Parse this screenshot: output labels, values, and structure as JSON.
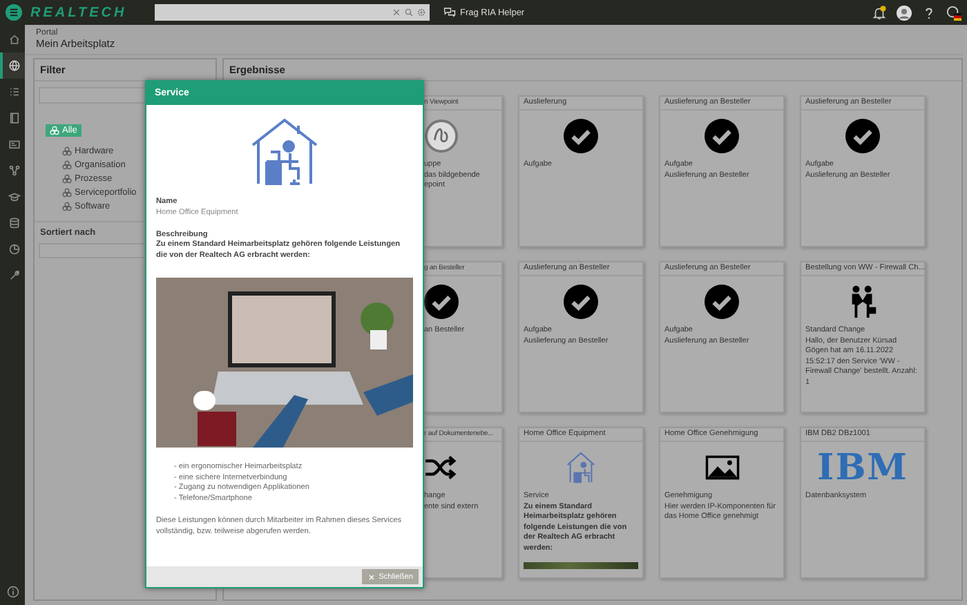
{
  "topbar": {
    "logo": "REALTECH",
    "assistant": "Frag RIA Helper"
  },
  "sidebar": {
    "items": [
      {
        "kind": "home",
        "selected": false
      },
      {
        "kind": "globe",
        "selected": true
      },
      {
        "kind": "list",
        "selected": false
      },
      {
        "kind": "book",
        "selected": false
      },
      {
        "kind": "card",
        "selected": false
      },
      {
        "kind": "network",
        "selected": false
      },
      {
        "kind": "cap",
        "selected": false
      },
      {
        "kind": "database",
        "selected": false
      },
      {
        "kind": "chart",
        "selected": false
      },
      {
        "kind": "wrench",
        "selected": false
      }
    ]
  },
  "breadcrumb": {
    "parent": "Portal",
    "title": "Mein Arbeitsplatz"
  },
  "filter": {
    "title": "Filter",
    "tree": [
      {
        "label": "Alle",
        "selected": true,
        "children": [
          {
            "label": "Hardware",
            "selected": false
          },
          {
            "label": "Organisation",
            "selected": false
          },
          {
            "label": "Prozesse",
            "selected": false
          },
          {
            "label": "Serviceportfolio",
            "selected": false
          },
          {
            "label": "Software",
            "selected": false
          }
        ]
      }
    ],
    "sort_label": "Sortiert nach"
  },
  "results": {
    "title": "Ergebnisse",
    "cards": [
      {
        "title": "n Viewpoint",
        "kind": "logo",
        "lines": [
          {
            "text": "uppe",
            "bold": false
          },
          {
            "text": "das bildgebende",
            "bold": false
          },
          {
            "text": "epoint",
            "bold": false
          }
        ]
      },
      {
        "title": "Auslieferung",
        "kind": "task",
        "lines": [
          {
            "text": "Aufgabe",
            "bold": false
          }
        ]
      },
      {
        "title": "Auslieferung an Besteller",
        "kind": "task",
        "lines": [
          {
            "text": "Aufgabe",
            "bold": false
          },
          {
            "text": "Auslieferung an Besteller",
            "bold": false
          }
        ]
      },
      {
        "title": "Auslieferung an Besteller",
        "kind": "task",
        "lines": [
          {
            "text": "Aufgabe",
            "bold": false
          },
          {
            "text": "Auslieferung an Besteller",
            "bold": false
          }
        ]
      },
      {
        "title": "g an Besteller",
        "kind": "task",
        "lines": [
          {
            "text": "an Besteller",
            "bold": false
          }
        ]
      },
      {
        "title": "Auslieferung an Besteller",
        "kind": "task",
        "lines": [
          {
            "text": "Aufgabe",
            "bold": false
          },
          {
            "text": "Auslieferung an Besteller",
            "bold": false
          }
        ]
      },
      {
        "title": "Auslieferung an Besteller",
        "kind": "task",
        "lines": [
          {
            "text": "Aufgabe",
            "bold": false
          },
          {
            "text": "Auslieferung an Besteller",
            "bold": false
          }
        ]
      },
      {
        "title": "Bestellung von WW - Firewall Ch...",
        "kind": "order",
        "lines": [
          {
            "text": "Standard Change",
            "bold": false
          },
          {
            "text": "Hallo, der Benutzer Kürsad Gögen hat am 16.11.2022 15:52:17 den Service 'WW - Firewall Change' bestellt. Anzahl: 1",
            "bold": false
          }
        ]
      },
      {
        "title": "r auf Dokumentenebe...",
        "kind": "change",
        "lines": [
          {
            "text": "hange",
            "bold": false
          },
          {
            "text": "ente sind extern",
            "bold": false
          }
        ]
      },
      {
        "title": "Home Office Equipment",
        "kind": "service",
        "lines": [
          {
            "text": "Service",
            "bold": false
          },
          {
            "text": "Zu einem Standard Heimarbeitsplatz gehören folgende Leistungen die von der Realtech AG erbracht werden:",
            "bold": true
          }
        ]
      },
      {
        "title": "Home Office Genehmigung",
        "kind": "approval",
        "lines": [
          {
            "text": "Genehmigung",
            "bold": false
          },
          {
            "text": "Hier werden IP-Komponenten für das Home Office genehmigt",
            "bold": false
          }
        ]
      },
      {
        "title": "IBM DB2 DBz1001",
        "kind": "system",
        "logo": "IBM",
        "lines": [
          {
            "text": "Datenbanksystem",
            "bold": false
          }
        ]
      }
    ]
  },
  "modal": {
    "title": "Service",
    "name_label": "Name",
    "name_value": "Home Office Equipment",
    "description_label": "Beschreibung",
    "intro": "Zu einem Standard Heimarbeitsplatz gehören folgende Leistungen die von der Realtech AG erbracht werden:",
    "bullets": [
      "- ein ergonomischer Heimarbeitsplatz",
      "- eine sichere Internetverbindung",
      "- Zugang zu notwendigen Applikationen",
      "- Telefone/Smartphone"
    ],
    "outro": "Diese Leistungen können durch Mitarbeiter im Rahmen dieses Services vollständig, bzw. teilweise abgerufen werden.",
    "close": "Schließen"
  }
}
